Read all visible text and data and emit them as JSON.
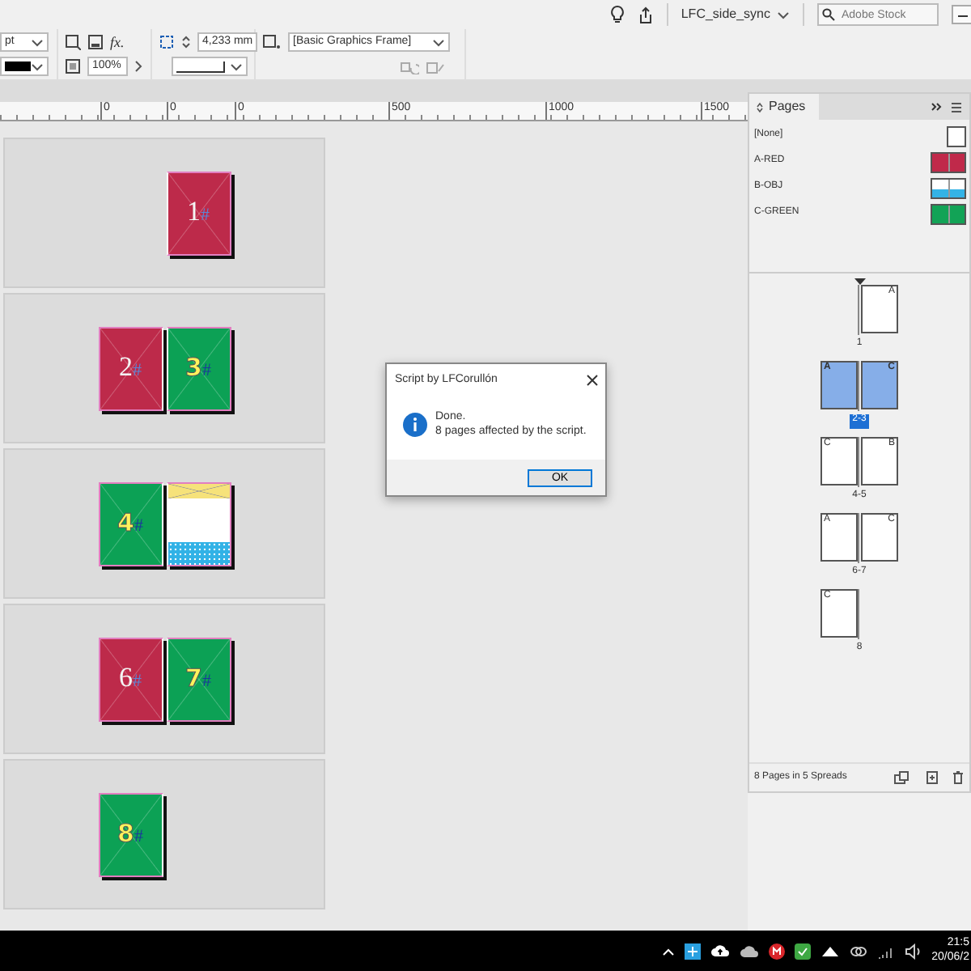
{
  "top_bar": {
    "workspace": "LFC_side_sync",
    "search": {
      "placeholder": "Adobe Stock"
    }
  },
  "control_bar": {
    "stroke_weight": "pt",
    "effects": "fx.",
    "opacity": "100%",
    "corner_size": "4,233 mm",
    "object_style": "[Basic Graphics Frame]"
  },
  "ruler": {
    "labels": [
      "0",
      "0",
      "0",
      "500",
      "1000",
      "1500"
    ]
  },
  "canvas": {
    "spreads": [
      {
        "pages": [
          {
            "number": "1",
            "marker": "#",
            "kind": "red",
            "recto": true
          }
        ]
      },
      {
        "pages": [
          {
            "number": "2",
            "marker": "#",
            "kind": "red",
            "recto": false
          },
          {
            "number": "3",
            "marker": "#",
            "kind": "green",
            "recto": true
          }
        ]
      },
      {
        "pages": [
          {
            "number": "4",
            "marker": "#",
            "kind": "green",
            "recto": false
          },
          {
            "kind": "obj",
            "recto": true
          }
        ]
      },
      {
        "pages": [
          {
            "number": "6",
            "marker": "#",
            "kind": "red",
            "recto": false
          },
          {
            "number": "7",
            "marker": "#",
            "kind": "green",
            "recto": true
          }
        ]
      },
      {
        "pages": [
          {
            "number": "8",
            "marker": "#",
            "kind": "green",
            "recto": false
          }
        ]
      }
    ]
  },
  "dialog": {
    "title": "Script by LFCorullón",
    "lines": [
      "Done.",
      "8 pages affected by the script."
    ],
    "button": "OK"
  },
  "pages_panel": {
    "tab": "Pages",
    "masters": [
      {
        "name": "[None]",
        "kind": "none"
      },
      {
        "name": "A-RED",
        "kind": "red"
      },
      {
        "name": "B-OBJ",
        "kind": "obj"
      },
      {
        "name": "C-GREEN",
        "kind": "green"
      }
    ],
    "spreads": [
      {
        "label": "1",
        "selected": false,
        "pages": [
          {
            "master": "A",
            "recto": true
          }
        ]
      },
      {
        "label": "2-3",
        "selected": true,
        "pages": [
          {
            "master": "A",
            "recto": false
          },
          {
            "master": "C",
            "recto": true
          }
        ]
      },
      {
        "label": "4-5",
        "selected": false,
        "pages": [
          {
            "master": "C",
            "recto": false
          },
          {
            "master": "B",
            "recto": true
          }
        ]
      },
      {
        "label": "6-7",
        "selected": false,
        "pages": [
          {
            "master": "A",
            "recto": false
          },
          {
            "master": "C",
            "recto": true
          }
        ]
      },
      {
        "label": "8",
        "selected": false,
        "pages": [
          {
            "master": "C",
            "recto": false
          }
        ]
      }
    ],
    "footer": "8 Pages in 5 Spreads"
  },
  "taskbar": {
    "time": "21:5",
    "date": "20/06/2"
  }
}
